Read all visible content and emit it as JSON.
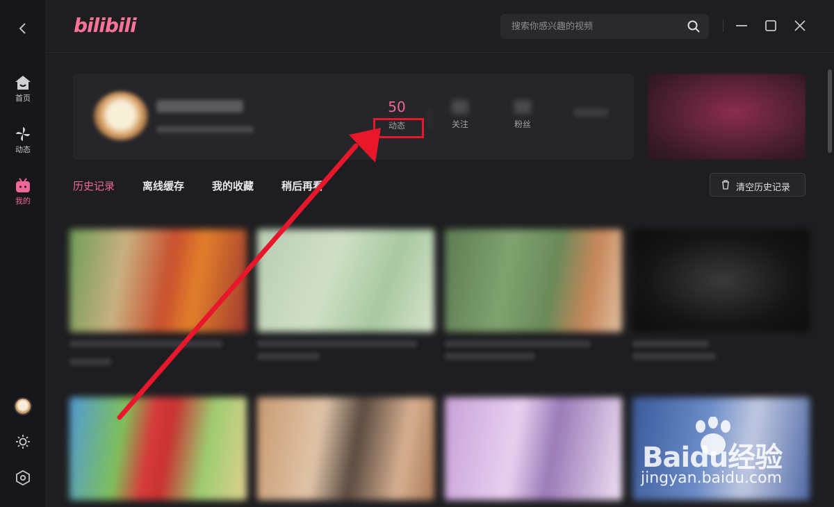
{
  "app": {
    "logo_text": "bilibili"
  },
  "sidebar": {
    "back_icon": "chevron-left-icon",
    "items": [
      {
        "label": "首页",
        "icon": "home-icon"
      },
      {
        "label": "动态",
        "icon": "pinwheel-icon"
      },
      {
        "label": "我的",
        "icon": "tv-icon",
        "active": true
      }
    ],
    "bottom": [
      {
        "icon": "avatar"
      },
      {
        "icon": "sun-icon"
      },
      {
        "icon": "settings-icon"
      }
    ]
  },
  "search": {
    "placeholder": "搜索你感兴趣的视频"
  },
  "profile": {
    "stats": [
      {
        "label": "动态",
        "value": "50"
      },
      {
        "label": "关注",
        "value": ""
      },
      {
        "label": "粉丝",
        "value": ""
      }
    ]
  },
  "tabs": [
    "历史记录",
    "离线缓存",
    "我的收藏",
    "稍后再看"
  ],
  "clear_button": "清空历史记录",
  "watermark": {
    "main": "Baidu经验",
    "sub": "jingyan.baidu.com"
  },
  "colors": {
    "accent": "#f0659a",
    "highlight": "#e8172b",
    "background": "#1e1e21"
  }
}
